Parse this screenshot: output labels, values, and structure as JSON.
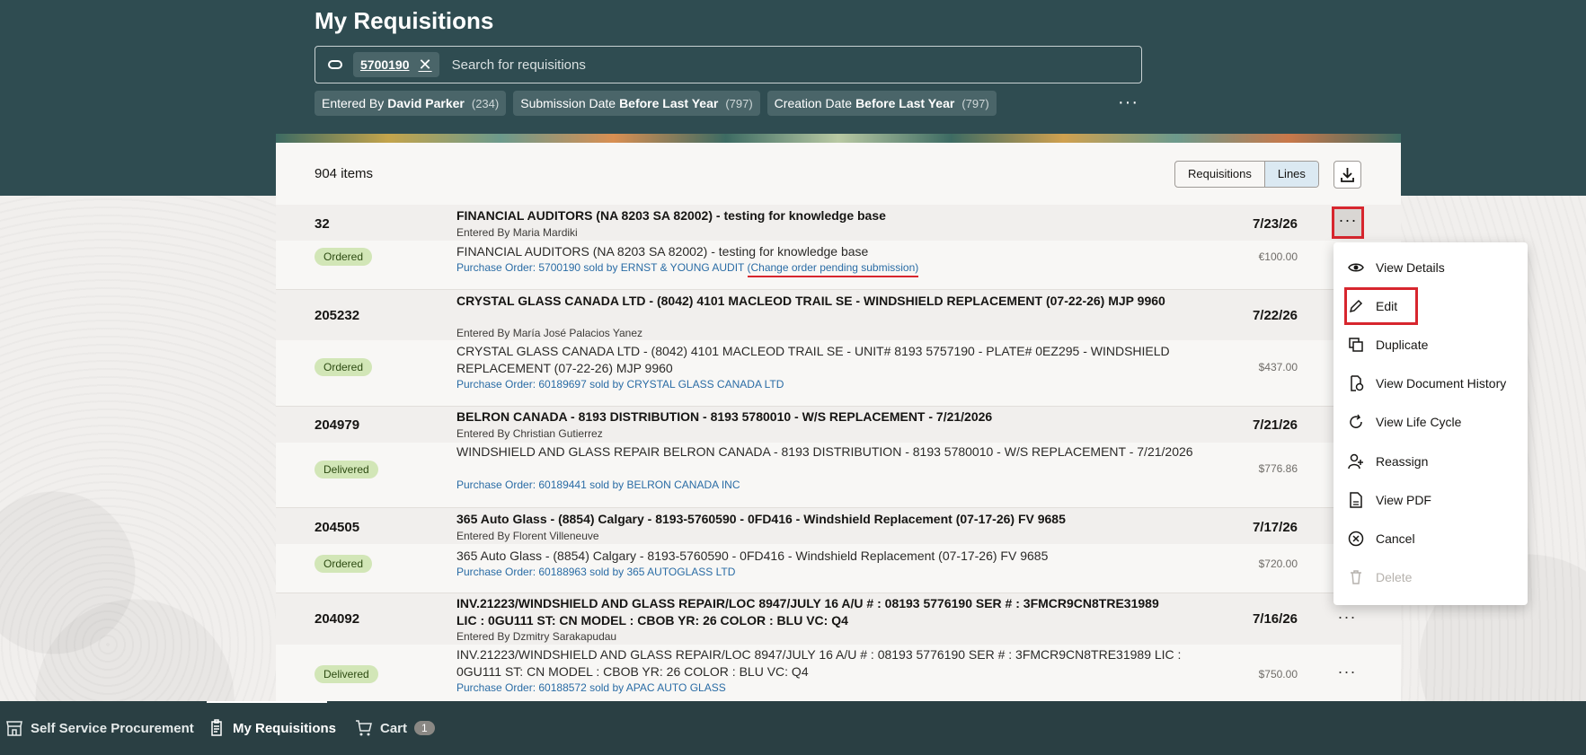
{
  "page_title": "My Requisitions",
  "search": {
    "chip_value": "5700190",
    "placeholder": "Search for requisitions"
  },
  "filters": [
    {
      "label": "Entered By",
      "value": "David Parker",
      "count": "(234)"
    },
    {
      "label": "Submission Date",
      "value": "Before Last Year",
      "count": "(797)"
    },
    {
      "label": "Creation Date",
      "value": "Before Last Year",
      "count": "(797)"
    }
  ],
  "items_count": "904 items",
  "view_toggle": {
    "requisitions": "Requisitions",
    "lines": "Lines",
    "selected": "Lines"
  },
  "rows": [
    {
      "number": "32",
      "title": "FINANCIAL AUDITORS (NA 8203 SA 82002) - testing for knowledge base",
      "entered_by": "Entered By Maria Mardiki",
      "date": "7/23/26",
      "status": "Ordered",
      "description": "FINANCIAL AUDITORS (NA 8203 SA 82002) - testing for knowledge base",
      "po": "Purchase Order: 5700190 sold by ERNST & YOUNG AUDIT",
      "po_note": "(Change order pending submission)",
      "amount": "€100.00"
    },
    {
      "number": "205232",
      "title": "CRYSTAL GLASS CANADA LTD - (8042) 4101 MACLEOD TRAIL SE - WINDSHIELD REPLACEMENT (07-22-26) MJP 9960",
      "entered_by": "Entered By María José Palacios Yanez",
      "date": "7/22/26",
      "status": "Ordered",
      "description": "CRYSTAL GLASS CANADA LTD - (8042) 4101 MACLEOD TRAIL SE - UNIT# 8193 5757190 - PLATE# 0EZ295 - WINDSHIELD REPLACEMENT (07-22-26) MJP 9960",
      "po": "Purchase Order: 60189697 sold by CRYSTAL GLASS CANADA LTD",
      "amount": "$437.00"
    },
    {
      "number": "204979",
      "title": "BELRON CANADA - 8193 DISTRIBUTION - 8193 5780010 - W/S REPLACEMENT - 7/21/2026",
      "entered_by": "Entered By Christian Gutierrez",
      "date": "7/21/26",
      "status": "Delivered",
      "description": "WINDSHIELD AND GLASS REPAIR BELRON CANADA - 8193 DISTRIBUTION - 8193 5780010 - W/S REPLACEMENT - 7/21/2026",
      "po": "Purchase Order: 60189441 sold by BELRON CANADA INC",
      "amount": "$776.86"
    },
    {
      "number": "204505",
      "title": "365 Auto Glass - (8854) Calgary - 8193-5760590 - 0FD416 - Windshield Replacement (07-17-26) FV 9685",
      "entered_by": "Entered By Florent Villeneuve",
      "date": "7/17/26",
      "status": "Ordered",
      "description": "365 Auto Glass - (8854) Calgary - 8193-5760590 - 0FD416 - Windshield Replacement (07-17-26) FV 9685",
      "po": "Purchase Order: 60188963 sold by 365 AUTOGLASS LTD",
      "amount": "$720.00"
    },
    {
      "number": "204092",
      "title": "INV.21223/WINDSHIELD AND GLASS REPAIR/LOC 8947/JULY 16 A/U # : 08193 5776190 SER # : 3FMCR9CN8TRE31989 LIC : 0GU111 ST: CN MODEL : CBOB YR: 26 COLOR : BLU VC: Q4",
      "entered_by": "Entered By Dzmitry Sarakapudau",
      "date": "7/16/26",
      "status": "Delivered",
      "description": "INV.21223/WINDSHIELD AND GLASS REPAIR/LOC 8947/JULY 16 A/U # : 08193 5776190 SER # : 3FMCR9CN8TRE31989 LIC : 0GU111 ST: CN MODEL : CBOB YR: 26 COLOR : BLU VC: Q4",
      "po": "Purchase Order: 60188572 sold by APAC AUTO GLASS",
      "amount": "$750.00"
    }
  ],
  "more_glyph": "···",
  "menu": [
    {
      "label": "View Details",
      "icon": "eye-icon"
    },
    {
      "label": "Edit",
      "icon": "pencil-icon"
    },
    {
      "label": "Duplicate",
      "icon": "duplicate-icon"
    },
    {
      "label": "View Document History",
      "icon": "document-history-icon"
    },
    {
      "label": "View Life Cycle",
      "icon": "lifecycle-icon"
    },
    {
      "label": "Reassign",
      "icon": "reassign-icon"
    },
    {
      "label": "View PDF",
      "icon": "pdf-icon"
    },
    {
      "label": "Cancel",
      "icon": "cancel-icon"
    },
    {
      "label": "Delete",
      "icon": "trash-icon",
      "disabled": true
    }
  ],
  "bottom_nav": {
    "self_service": "Self Service Procurement",
    "my_requisitions": "My Requisitions",
    "cart": "Cart",
    "cart_count": "1"
  },
  "colors": {
    "header_bg": "#2f4c51",
    "status_badge": "#d2e6b7",
    "link": "#2a6ca5",
    "highlight": "#d7262e"
  }
}
